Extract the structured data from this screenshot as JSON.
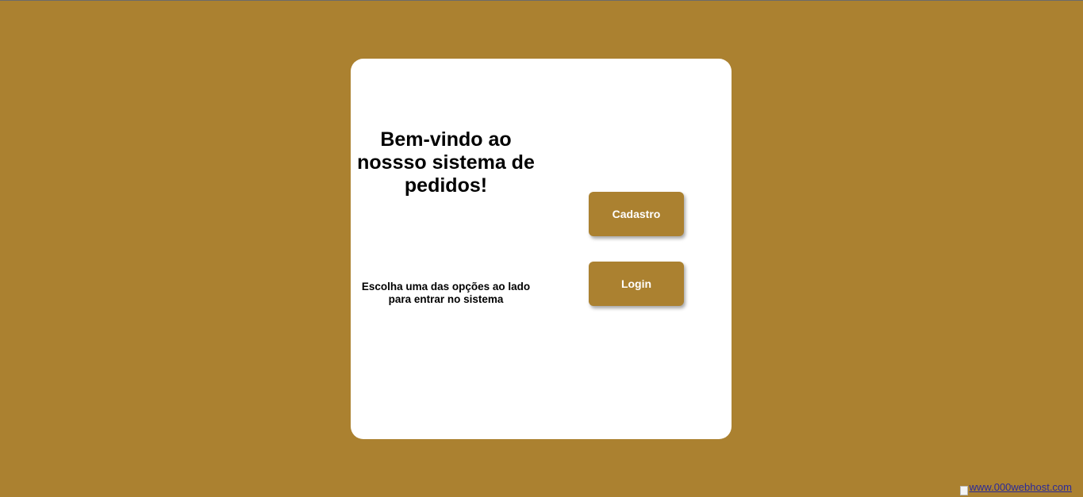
{
  "welcome": {
    "title": "Bem-vindo ao nossso sistema de pedidos!",
    "instruction": "Escolha uma das opções ao lado para entrar no sistema"
  },
  "buttons": {
    "cadastro_label": "Cadastro",
    "login_label": "Login"
  },
  "footer": {
    "host_link_text": "www.000webhost.com"
  },
  "colors": {
    "background": "#ab8130",
    "card": "#ffffff",
    "button": "#ab8130",
    "button_text": "#ffffff"
  }
}
